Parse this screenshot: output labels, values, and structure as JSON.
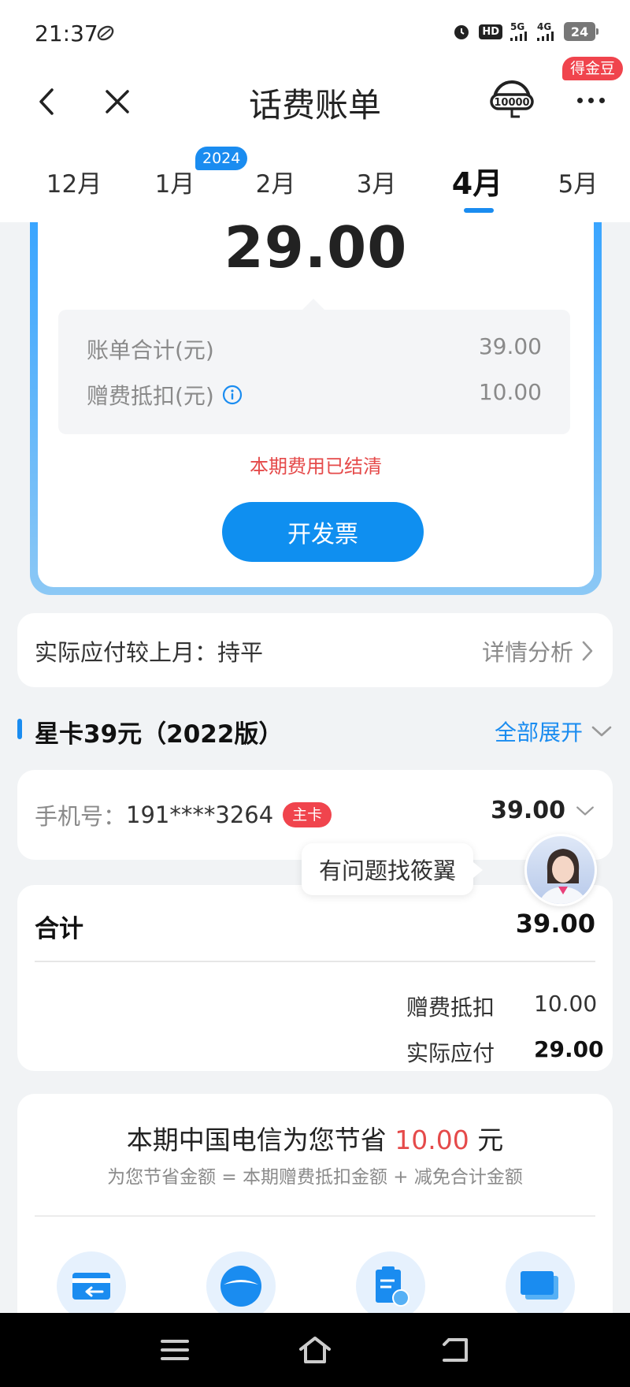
{
  "status_bar": {
    "time": "21:37",
    "hd_label": "HD",
    "signal_1_label": "5G",
    "signal_2_label": "4G",
    "battery": "24"
  },
  "nav": {
    "title": "话费账单",
    "gold_badge": "得金豆",
    "hotline_label": "10000"
  },
  "month_tabs": {
    "year_badge": "2024",
    "items": [
      {
        "label": "12月"
      },
      {
        "label": "1月"
      },
      {
        "label": "2月"
      },
      {
        "label": "3月"
      },
      {
        "label": "4月",
        "selected": true
      },
      {
        "label": "5月"
      }
    ]
  },
  "bill": {
    "amount": "29.00",
    "total_label": "账单合计(元)",
    "total_value": "39.00",
    "deduct_label": "赠费抵扣(元)",
    "deduct_value": "10.00",
    "status": "本期费用已结清",
    "invoice_button": "开发票"
  },
  "compare": {
    "label": "实际应付较上月：持平",
    "link": "详情分析"
  },
  "plan": {
    "name": "星卡39元（2022版）",
    "expand_label": "全部展开"
  },
  "phone": {
    "label": "手机号：",
    "number": "191****3264",
    "badge": "主卡",
    "amount": "39.00"
  },
  "assistant": {
    "bubble": "有问题找筱翼"
  },
  "total": {
    "label": "合计",
    "value": "39.00",
    "deduct_label": "赠费抵扣",
    "deduct_value": "10.00",
    "actual_label": "实际应付",
    "actual_value": "29.00"
  },
  "savings": {
    "prefix": "本期中国电信为您节省 ",
    "amount": "10.00",
    "suffix": " 元",
    "formula": "为您节省金额 = 本期赠费抵扣金额 + 减免合计金额",
    "feature_icons": [
      "card-transfer-icon",
      "ball-icon",
      "clipboard-yuan-icon",
      "screen-yuan-icon"
    ]
  },
  "colors": {
    "accent": "#1a8cf0",
    "danger": "#e54a4a",
    "badge_red": "#f0444d"
  }
}
